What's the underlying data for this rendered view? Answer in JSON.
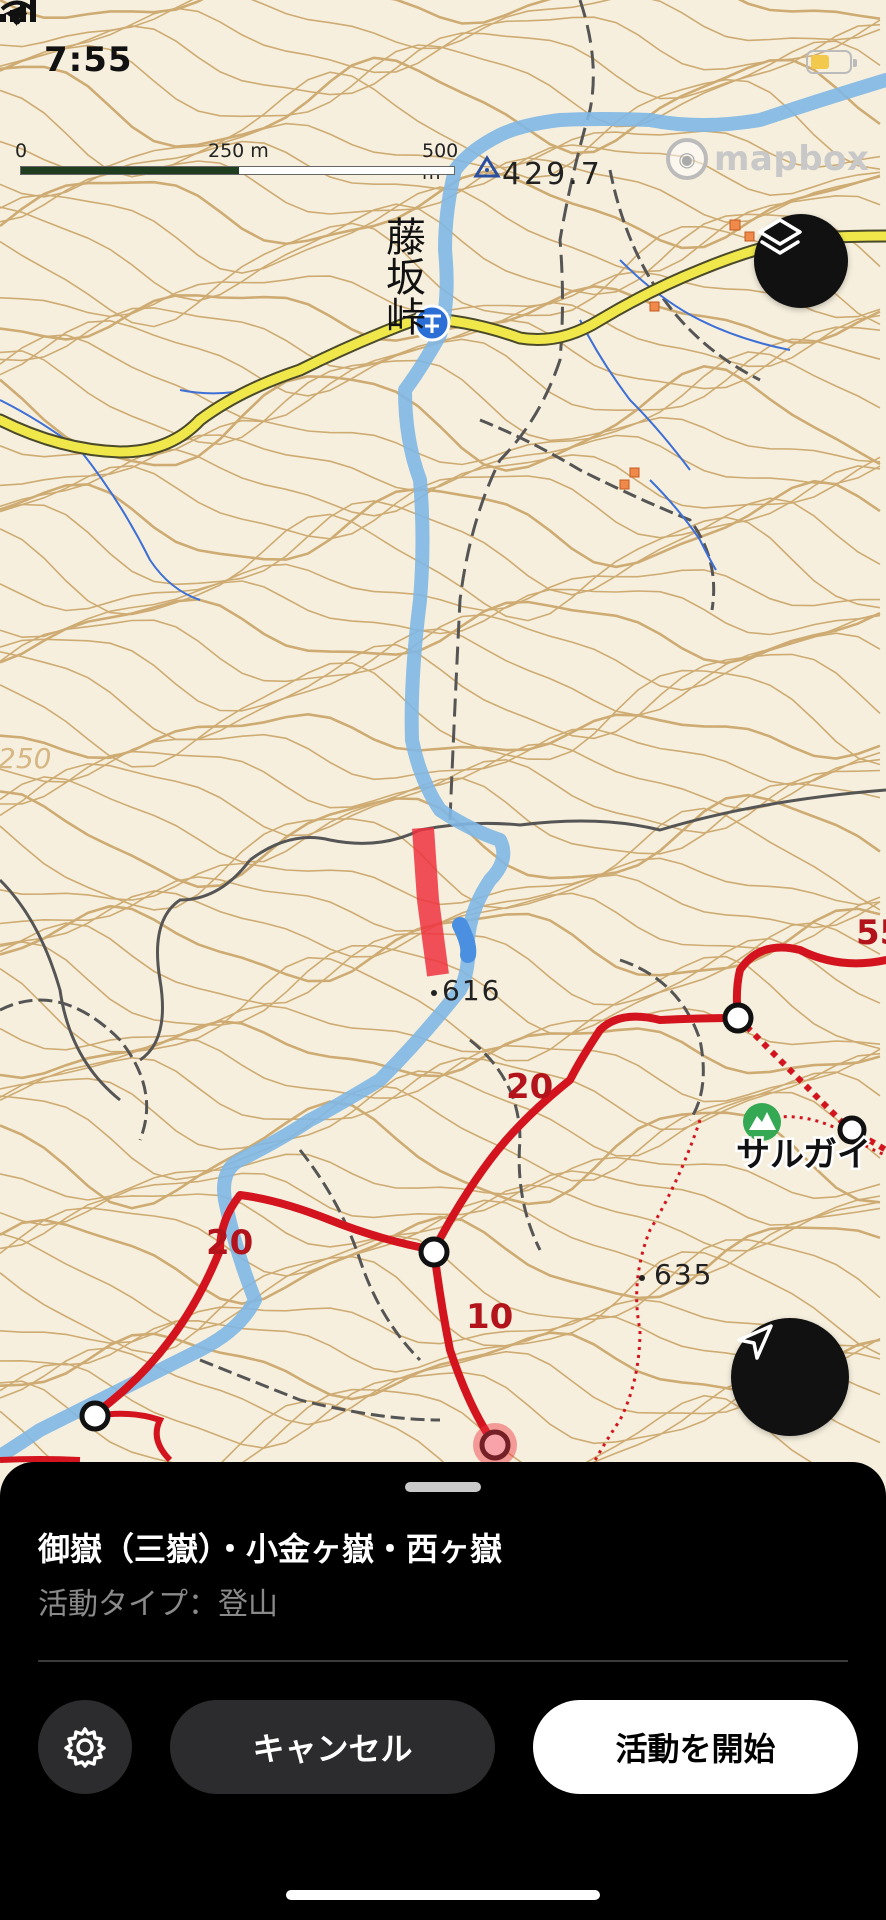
{
  "status_bar": {
    "time": "7:55"
  },
  "map": {
    "scale": {
      "zero": "0",
      "mid": "250 m",
      "max": "500 m"
    },
    "attribution": "mapbox",
    "labels": {
      "pass_name": "藤坂峠",
      "peak_4297": "429.7",
      "elev_616": "616",
      "elev_635": "635",
      "elev_250": "250",
      "time_20_a": "20",
      "time_20_b": "20",
      "time_10": "10",
      "time_55": "55",
      "sarugai": "サルガイ"
    },
    "colors": {
      "contour": "#c8a060",
      "road": "#f0e84a",
      "track": "#7fb7e6",
      "route": "#d3141e",
      "highlight": "#ef3340"
    }
  },
  "sheet": {
    "title": "御嶽（三嶽）・小金ヶ嶽・西ヶ嶽",
    "subtitle": "活動タイプ：登山",
    "cancel_label": "キャンセル",
    "start_label": "活動を開始"
  }
}
